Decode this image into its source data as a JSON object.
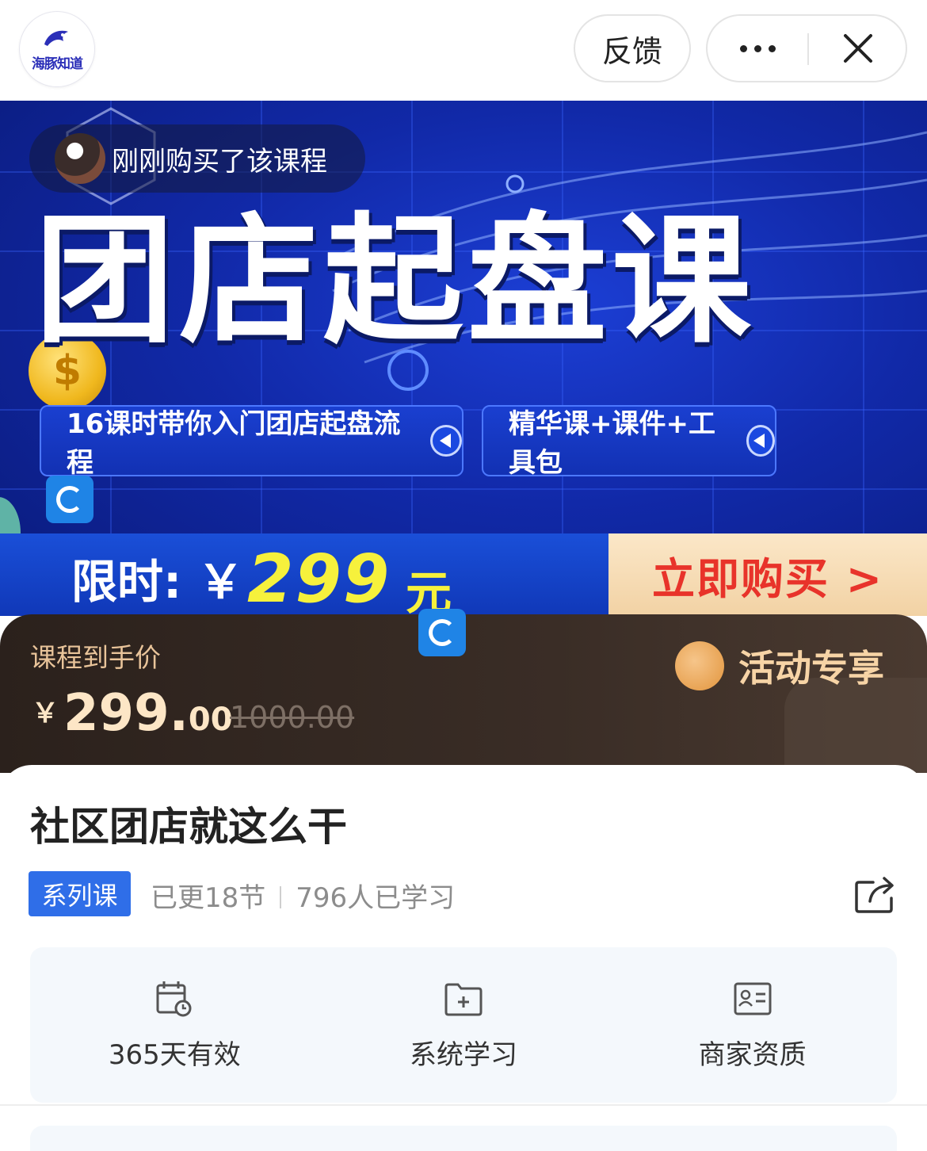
{
  "header": {
    "logo_text": "海豚知道",
    "feedback_label": "反馈"
  },
  "banner": {
    "buyer_toast": "刚刚购买了该课程",
    "title": "团店起盘课",
    "coin_symbol": "$",
    "tag1": "16课时带你入门团店起盘流程",
    "tag2": "精华课+课件+工具包",
    "limit_label": "限时: ￥",
    "limit_price": "299",
    "limit_unit": "元",
    "buy_now": "立即购买 >"
  },
  "price_panel": {
    "label": "课程到手价",
    "currency": "￥",
    "price_int": "299.",
    "price_dec": "00",
    "original_price": "1000.00",
    "badge_text": "活动专享"
  },
  "course": {
    "title": "社区团店就这么干",
    "series_badge": "系列课",
    "updated": "已更18节",
    "learners": "796人已学习"
  },
  "features": [
    {
      "icon": "calendar-clock-icon",
      "label": "365天有效"
    },
    {
      "icon": "folder-plus-icon",
      "label": "系统学习"
    },
    {
      "icon": "id-card-icon",
      "label": "商家资质"
    }
  ],
  "colors": {
    "banner_blue": "#1129a8",
    "price_yellow": "#f6f13c",
    "buy_red": "#e8332a",
    "series_blue": "#2f6ee8",
    "panel_dark": "#2b211c",
    "panel_gold": "#e9c49a"
  }
}
